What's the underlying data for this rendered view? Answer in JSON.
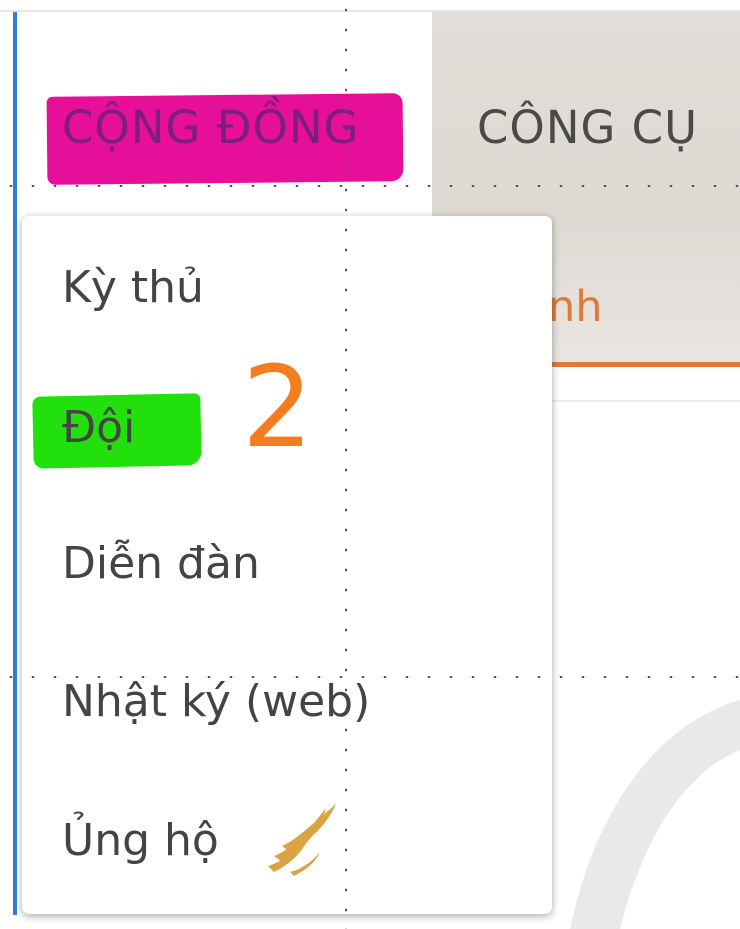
{
  "nav": {
    "community_tab": "CỘNG ĐỒNG",
    "tools_tab": "CÔNG CỤ",
    "tools_partial_text": "nh"
  },
  "dropdown": {
    "items": [
      {
        "label": "Kỳ thủ"
      },
      {
        "label": "Đội"
      },
      {
        "label": "Diễn đàn"
      },
      {
        "label": "Nhật ký (web)"
      },
      {
        "label": "Ủng hộ",
        "icon": "wing-icon"
      }
    ]
  },
  "annotation": {
    "step_number": "2",
    "community_highlight_color": "#e60f9a",
    "team_highlight_color": "#22e00b",
    "number_color": "#f57d1f"
  },
  "colors": {
    "accent_orange": "#e07a3a",
    "left_accent_blue": "#2f7fd8",
    "wing_gold": "#d9a441"
  }
}
